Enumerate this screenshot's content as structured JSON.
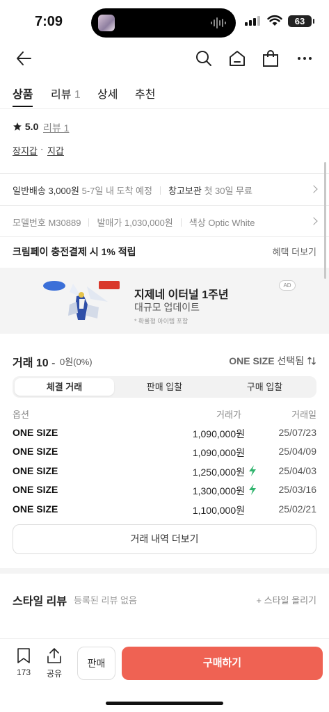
{
  "status_bar": {
    "time": "7:09",
    "battery": "63"
  },
  "header": {
    "back_icon": "arrow-left-icon",
    "icons": [
      "search-icon",
      "home-icon",
      "shopping-bag-icon",
      "more-icon"
    ]
  },
  "tabs": [
    {
      "label": "상품",
      "count": "",
      "active": true
    },
    {
      "label": "리뷰",
      "count": "1",
      "active": false
    },
    {
      "label": "상세",
      "count": "",
      "active": false
    },
    {
      "label": "추천",
      "count": "",
      "active": false
    }
  ],
  "rating": {
    "score": "5.0",
    "review_link": "리뷰 1"
  },
  "categories": [
    "장지갑",
    "지갑"
  ],
  "shipping": {
    "label": "일반배송",
    "price": "3,000원",
    "eta": "5-7일 내 도착 예정",
    "storage_label": "창고보관",
    "storage_note": "첫 30일 무료"
  },
  "specs": {
    "model_label": "모델번호",
    "model": "M30889",
    "release_label": "발매가",
    "release_price": "1,030,000원",
    "color_label": "색상",
    "color": "Optic White"
  },
  "promo": {
    "title": "크림페이 충전결제 시 1% 적립",
    "link": "혜택 더보기"
  },
  "ad": {
    "title": "지제네 이터널 1주년",
    "subtitle": "대규모 업데이트",
    "note": "* 확률형 아이템 포함",
    "tag": "AD"
  },
  "trades": {
    "title": "거래 10",
    "dash": "-",
    "change": "0원(0%)",
    "size_selected": "ONE SIZE",
    "size_suffix": "선택됨",
    "segments": [
      "체결 거래",
      "판매 입찰",
      "구매 입찰"
    ],
    "columns": [
      "옵션",
      "거래가",
      "거래일"
    ],
    "rows": [
      {
        "size": "ONE SIZE",
        "price": "1,090,000원",
        "fast": false,
        "date": "25/07/23"
      },
      {
        "size": "ONE SIZE",
        "price": "1,090,000원",
        "fast": false,
        "date": "25/04/09"
      },
      {
        "size": "ONE SIZE",
        "price": "1,250,000원",
        "fast": true,
        "date": "25/04/03"
      },
      {
        "size": "ONE SIZE",
        "price": "1,300,000원",
        "fast": true,
        "date": "25/03/16"
      },
      {
        "size": "ONE SIZE",
        "price": "1,100,000원",
        "fast": false,
        "date": "25/02/21"
      }
    ],
    "more_label": "거래 내역 더보기"
  },
  "style_review": {
    "title": "스타일 리뷰",
    "subtitle": "등록된 리뷰 없음",
    "link": "+ 스타일 올리기"
  },
  "bottom": {
    "bookmark_count": "173",
    "share_label": "공유",
    "sell_label": "판매",
    "buy_label": "구매하기",
    "buy_color": "#ef6253"
  }
}
